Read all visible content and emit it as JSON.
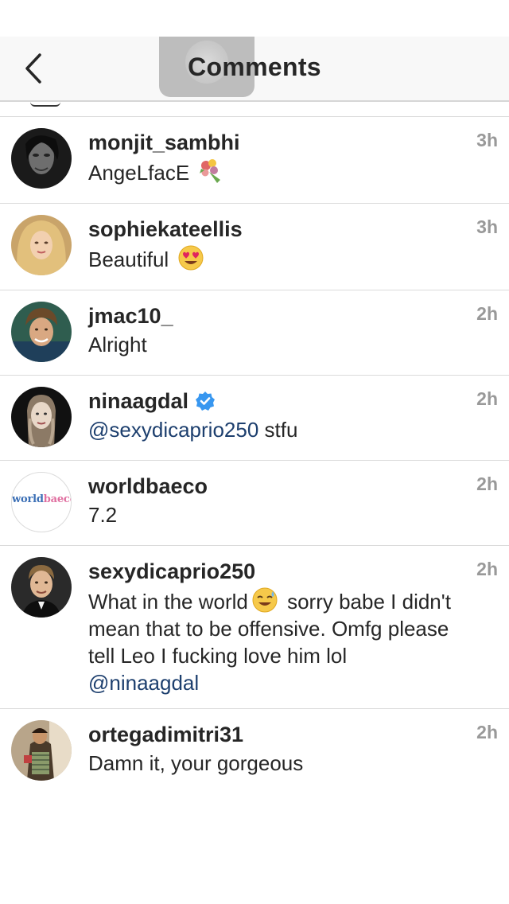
{
  "header": {
    "title": "Comments",
    "back_icon": "chevron-left-icon"
  },
  "colors": {
    "mention": "#1d3f6e",
    "timestamp": "#999999",
    "verified": "#3897f0",
    "divider": "#dbdbdb"
  },
  "comments": [
    {
      "username": "monjit_sambhi",
      "text": "AngeLfacE",
      "emoji": "bouquet-emoji",
      "time": "3h"
    },
    {
      "username": "sophiekateellis",
      "text": "Beautiful",
      "emoji": "heart-eyes-emoji",
      "time": "3h"
    },
    {
      "username": "jmac10_",
      "text": "Alright",
      "time": "2h"
    },
    {
      "username": "ninaagdal",
      "verified": true,
      "mention": "@sexydicaprio250",
      "text": " stfu",
      "time": "2h"
    },
    {
      "username": "worldbaeco",
      "text": "7.2",
      "time": "2h",
      "avatar_text_a": "world",
      "avatar_text_b": "baeco"
    },
    {
      "username": "sexydicaprio250",
      "text_before": "What in the world",
      "emoji": "sweat-smile-emoji",
      "text_after": " sorry babe I didn't mean that to be offensive. Omfg please tell Leo I fucking love him lol ",
      "mention": "@ninaagdal",
      "time": "2h"
    },
    {
      "username": "ortegadimitri31",
      "text": "Damn it, your gorgeous",
      "time": "2h"
    }
  ]
}
